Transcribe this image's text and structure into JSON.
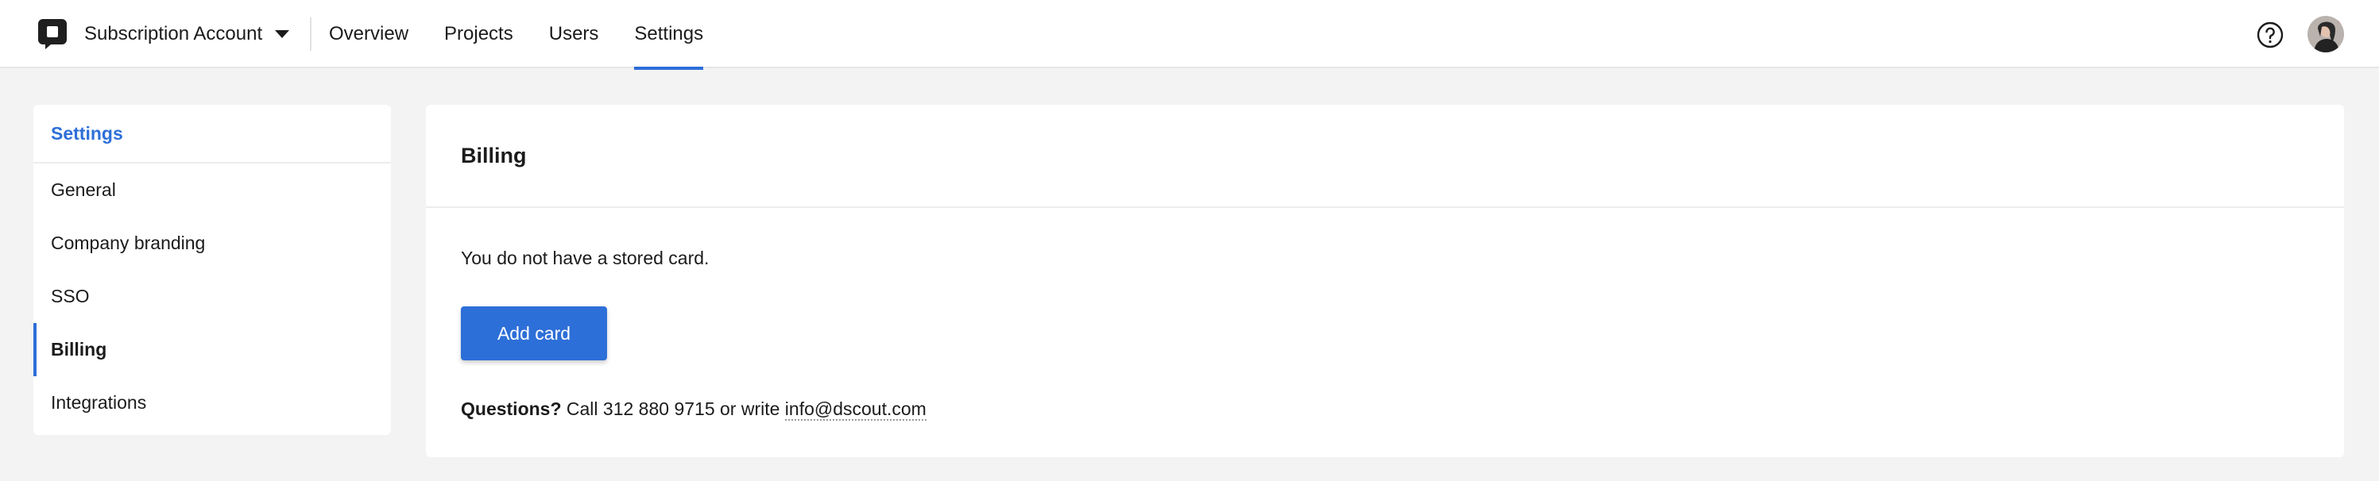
{
  "header": {
    "account_name": "Subscription Account",
    "nav": [
      {
        "label": "Overview",
        "active": false
      },
      {
        "label": "Projects",
        "active": false
      },
      {
        "label": "Users",
        "active": false
      },
      {
        "label": "Settings",
        "active": true
      }
    ],
    "icons": {
      "logo": "chat-bubble-logo-icon",
      "dropdown": "caret-down-icon",
      "help": "question-mark-icon",
      "avatar": "user-avatar"
    }
  },
  "sidebar": {
    "title": "Settings",
    "items": [
      {
        "label": "General",
        "active": false
      },
      {
        "label": "Company branding",
        "active": false
      },
      {
        "label": "SSO",
        "active": false
      },
      {
        "label": "Billing",
        "active": true
      },
      {
        "label": "Integrations",
        "active": false
      }
    ]
  },
  "billing": {
    "title": "Billing",
    "message": "You do not have a stored card.",
    "add_button": "Add card",
    "questions_label": "Questions?",
    "questions_text": " Call 312 880 9715 or write ",
    "email": "info@dscout.com"
  },
  "colors": {
    "accent": "#2d6fd8",
    "background": "#f3f3f3",
    "surface": "#ffffff",
    "text": "#1b1b1b"
  }
}
